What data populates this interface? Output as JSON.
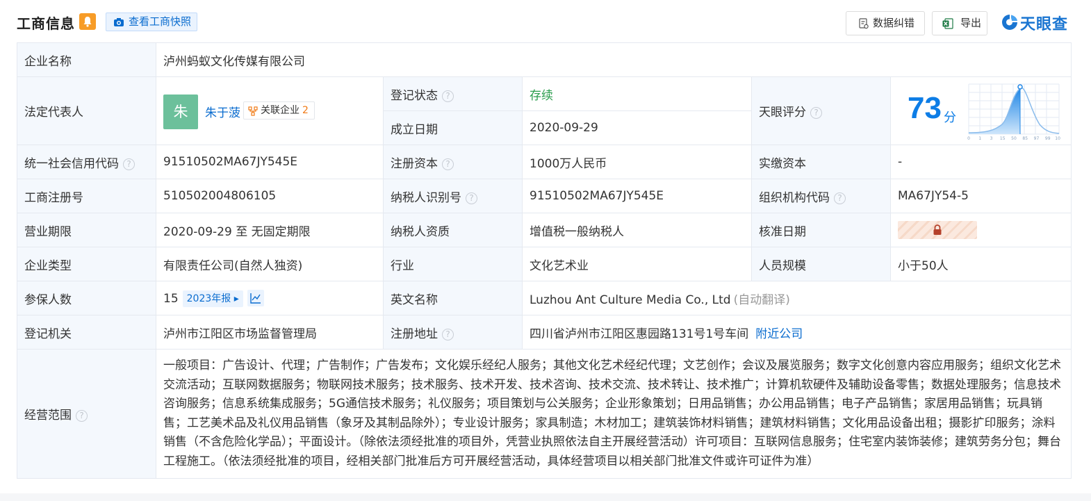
{
  "header": {
    "title": "工商信息",
    "snapshot_label": "查看工商快照",
    "correct_label": "数据纠错",
    "export_label": "导出",
    "logo_text": "天眼查"
  },
  "colors": {
    "accent": "#0a6ccf",
    "status_green": "#2a9d4c",
    "key_bg": "#f4f8fd",
    "score_blue": "#0d7de6"
  },
  "company": {
    "name_label": "企业名称",
    "name_value": "泸州蚂蚁文化传媒有限公司"
  },
  "rep": {
    "label": "法定代表人",
    "avatar": "朱",
    "name": "朱于菠",
    "related_label": "关联企业",
    "related_count": "2"
  },
  "reg_status": {
    "label": "登记状态",
    "value": "存续"
  },
  "found_date": {
    "label": "成立日期",
    "value": "2020-09-29"
  },
  "score": {
    "label": "天眼评分",
    "value": "73",
    "unit": "分",
    "chart_ticks": [
      "0",
      "1",
      "3",
      "15",
      "50",
      "85",
      "97",
      "99",
      "100"
    ]
  },
  "credit_code": {
    "label": "统一社会信用代码",
    "value": "91510502MA67JY545E"
  },
  "reg_capital": {
    "label": "注册资本",
    "value": "1000万人民币"
  },
  "paid_capital": {
    "label": "实缴资本",
    "value": "-"
  },
  "reg_no": {
    "label": "工商注册号",
    "value": "510502004806105"
  },
  "taxpayer_id": {
    "label": "纳税人识别号",
    "value": "91510502MA67JY545E"
  },
  "org_code": {
    "label": "组织机构代码",
    "value": "MA67JY54-5"
  },
  "term": {
    "label": "营业期限",
    "value": "2020-09-29 至 无固定期限"
  },
  "taxpayer_type": {
    "label": "纳税人资质",
    "value": "增值税一般纳税人"
  },
  "approve_date": {
    "label": "核准日期"
  },
  "company_type": {
    "label": "企业类型",
    "value": "有限责任公司(自然人独资)"
  },
  "industry": {
    "label": "行业",
    "value": "文化艺术业"
  },
  "staff_size": {
    "label": "人员规模",
    "value": "小于50人"
  },
  "insured": {
    "label": "参保人数",
    "value": "15",
    "report_tag": "2023年报"
  },
  "english_name": {
    "label": "英文名称",
    "value": "Luzhou Ant Culture Media Co., Ltd",
    "auto": "(自动翻译)"
  },
  "authority": {
    "label": "登记机关",
    "value": "泸州市江阳区市场监督管理局"
  },
  "address": {
    "label": "注册地址",
    "value": "四川省泸州市江阳区惠园路131号1号车间",
    "nearby": "附近公司"
  },
  "scope": {
    "label": "经营范围",
    "value": "一般项目：广告设计、代理；广告制作；广告发布；文化娱乐经纪人服务；其他文化艺术经纪代理；文艺创作；会议及展览服务；数字文化创意内容应用服务；组织文化艺术交流活动；互联网数据服务；物联网技术服务；技术服务、技术开发、技术咨询、技术交流、技术转让、技术推广；计算机软硬件及辅助设备零售；数据处理服务；信息技术咨询服务；信息系统集成服务；5G通信技术服务；礼仪服务；项目策划与公关服务；企业形象策划；日用品销售；办公用品销售；电子产品销售；家居用品销售；玩具销售；工艺美术品及礼仪用品销售（象牙及其制品除外）；专业设计服务；家具制造；木材加工；建筑装饰材料销售；建筑材料销售；文化用品设备出租；摄影扩印服务；涂料销售（不含危险化学品）；平面设计。（除依法须经批准的项目外，凭营业执照依法自主开展经营活动）许可项目：互联网信息服务；住宅室内装饰装修；建筑劳务分包；舞台工程施工。（依法须经批准的项目，经相关部门批准后方可开展经营活动，具体经营项目以相关部门批准文件或许可证件为准）"
  }
}
